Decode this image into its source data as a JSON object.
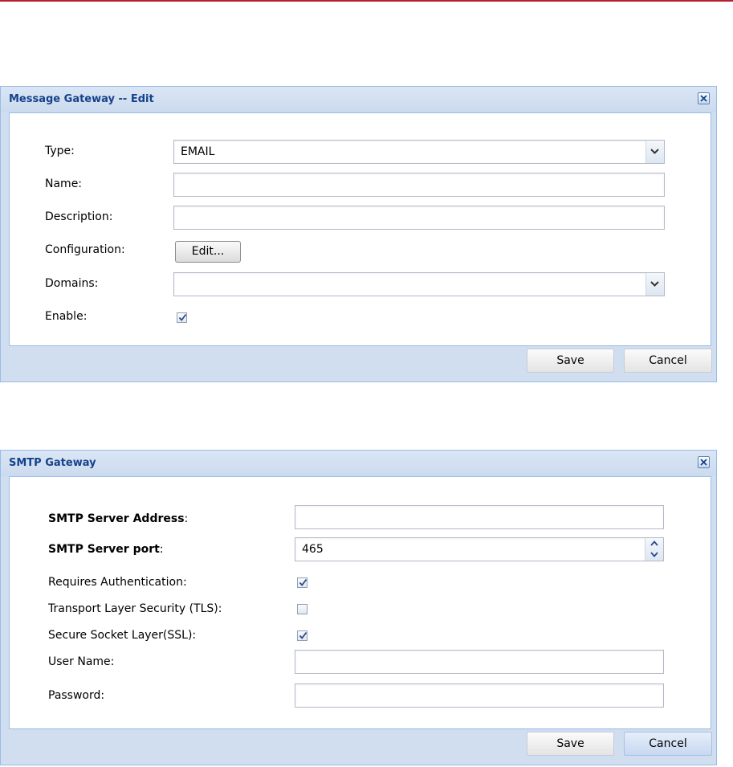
{
  "dialog1": {
    "title": "Message Gateway -- Edit",
    "close_icon": "close-icon",
    "fields": {
      "type": {
        "label": "Type:",
        "value": "EMAIL"
      },
      "name": {
        "label": "Name:",
        "value": ""
      },
      "description": {
        "label": "Description:",
        "value": ""
      },
      "configuration": {
        "label": "Configuration:",
        "button": "Edit..."
      },
      "domains": {
        "label": "Domains:",
        "value": ""
      },
      "enable": {
        "label": "Enable:",
        "checked": true
      }
    },
    "save_label": "Save",
    "cancel_label": "Cancel"
  },
  "dialog2": {
    "title": "SMTP Gateway",
    "close_icon": "close-icon",
    "fields": {
      "server_address": {
        "label": "SMTP Server Address",
        "suffix": ":",
        "value": ""
      },
      "server_port": {
        "label": "SMTP Server port",
        "suffix": ":",
        "value": "465"
      },
      "requires_auth": {
        "label": "Requires Authentication:",
        "checked": true
      },
      "tls": {
        "label": "Transport Layer Security (TLS):",
        "checked": false
      },
      "ssl": {
        "label": "Secure Socket Layer(SSL):",
        "checked": true
      },
      "user_name": {
        "label": "User Name:",
        "value": ""
      },
      "password": {
        "label": "Password:",
        "value": ""
      }
    },
    "save_label": "Save",
    "cancel_label": "Cancel"
  },
  "colors": {
    "header_text": "#15428b",
    "dialog_frame": "#d0def0",
    "top_line": "#b3202b"
  }
}
